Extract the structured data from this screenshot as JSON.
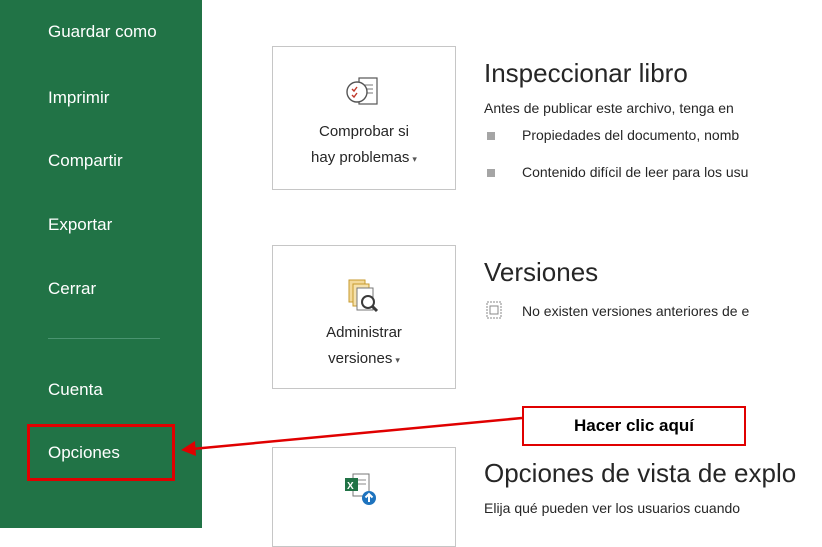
{
  "sidebar": {
    "items": [
      {
        "label": "Guardar como"
      },
      {
        "label": "Imprimir"
      },
      {
        "label": "Compartir"
      },
      {
        "label": "Exportar"
      },
      {
        "label": "Cerrar"
      },
      {
        "label": "Cuenta"
      },
      {
        "label": "Opciones"
      }
    ]
  },
  "sections": {
    "inspect": {
      "button_line1": "Comprobar si",
      "button_line2": "hay problemas",
      "title": "Inspeccionar libro",
      "description": "Antes de publicar este archivo, tenga en",
      "bullets": [
        "Propiedades del documento, nomb",
        "Contenido difícil de leer para los usu"
      ]
    },
    "versions": {
      "button_line1": "Administrar",
      "button_line2": "versiones",
      "title": "Versiones",
      "description": "No existen versiones anteriores de e"
    },
    "browser": {
      "title": "Opciones de vista de explo",
      "description": "Elija qué pueden ver los usuarios cuando"
    }
  },
  "annotation": {
    "callout_text": "Hacer clic aquí",
    "color": "#e00000"
  },
  "colors": {
    "sidebar_bg": "#217346",
    "sidebar_text": "#ffffff",
    "content_text": "#262626"
  }
}
